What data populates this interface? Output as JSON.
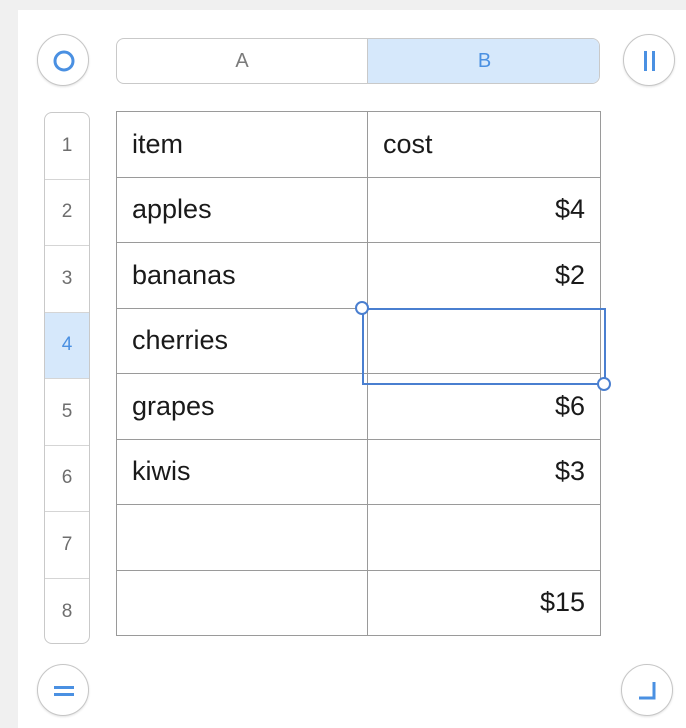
{
  "toolbar": {
    "top_left_icon": "select-table-circle-icon",
    "top_right_icon": "pause-columns-icon",
    "bottom_left_icon": "equals-rows-icon",
    "bottom_right_icon": "resize-corner-icon"
  },
  "columns": [
    {
      "label": "A",
      "selected": false
    },
    {
      "label": "B",
      "selected": true
    }
  ],
  "rows": [
    {
      "num": "1",
      "selected": false,
      "item": "item",
      "cost": "cost"
    },
    {
      "num": "2",
      "selected": false,
      "item": "apples",
      "cost": "$4"
    },
    {
      "num": "3",
      "selected": false,
      "item": "bananas",
      "cost": "$2"
    },
    {
      "num": "4",
      "selected": true,
      "item": "cherries",
      "cost": ""
    },
    {
      "num": "5",
      "selected": false,
      "item": "grapes",
      "cost": "$6"
    },
    {
      "num": "6",
      "selected": false,
      "item": "kiwis",
      "cost": "$3"
    },
    {
      "num": "7",
      "selected": false,
      "item": "",
      "cost": ""
    },
    {
      "num": "8",
      "selected": false,
      "item": "",
      "cost": "$15"
    }
  ],
  "colors": {
    "accent": "#4a90e2",
    "selection_fill": "#d6e8fb",
    "selection_border": "#4a7fd0"
  }
}
